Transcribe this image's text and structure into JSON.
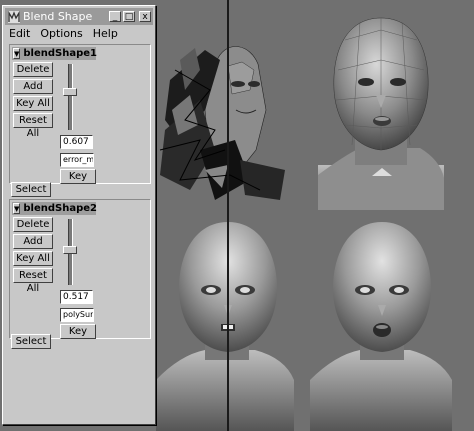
{
  "window": {
    "title": "Blend Shape",
    "controls": [
      "_",
      "□",
      "x"
    ]
  },
  "menu": [
    "Edit",
    "Options",
    "Help"
  ],
  "shapes": [
    {
      "name": "blendShape1",
      "buttons": {
        "delete": "Delete",
        "add": "Add",
        "key_all": "Key All",
        "reset_all": "Reset All"
      },
      "weight": "0.607",
      "weight_fraction": 0.607,
      "target": "error_m_",
      "key": "Key",
      "select": "Select"
    },
    {
      "name": "blendShape2",
      "buttons": {
        "delete": "Delete",
        "add": "Add",
        "key_all": "Key All",
        "reset_all": "Reset All"
      },
      "weight": "0.517",
      "weight_fraction": 0.517,
      "target": "polySurfa",
      "key": "Key",
      "select": "Select"
    }
  ],
  "viewport": {
    "background": "#707070",
    "heads": [
      {
        "name": "broken-blend-head",
        "style": "shattered"
      },
      {
        "name": "low-poly-head",
        "style": "faceted"
      },
      {
        "name": "smooth-head-closed-mouth",
        "style": "smooth"
      },
      {
        "name": "smooth-head-open-mouth",
        "style": "smooth"
      }
    ]
  }
}
